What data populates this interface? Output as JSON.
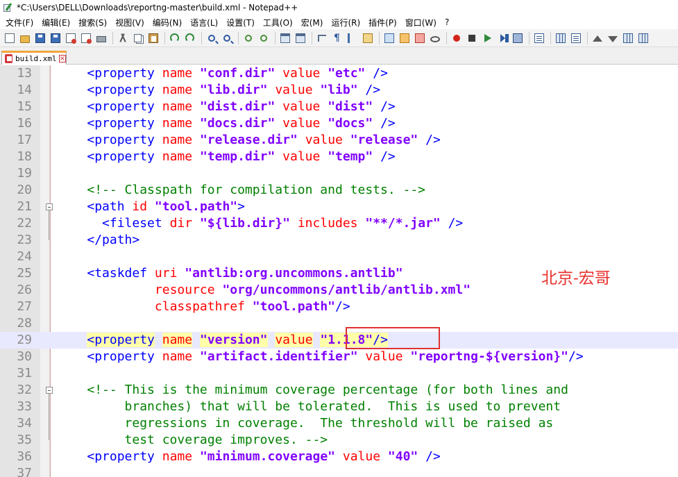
{
  "window": {
    "title": "*C:\\Users\\DELL\\Downloads\\reportng-master\\build.xml - Notepad++"
  },
  "menu": [
    "文件(F)",
    "编辑(E)",
    "搜索(S)",
    "视图(V)",
    "编码(N)",
    "语言(L)",
    "设置(T)",
    "工具(O)",
    "宏(M)",
    "运行(R)",
    "插件(P)",
    "窗口(W)",
    "?"
  ],
  "toolbar_icons": [
    "new-file-icon",
    "open-folder-icon",
    "save-icon",
    "save-all-icon",
    "close-file-icon",
    "close-all-icon",
    "print-icon",
    "cut-icon",
    "copy-icon",
    "paste-icon",
    "undo-icon",
    "redo-icon",
    "find-icon",
    "replace-icon",
    "zoom-in-icon",
    "zoom-out-icon",
    "sync-vertical-icon",
    "sync-horizontal-icon",
    "word-wrap-icon",
    "show-all-chars-icon",
    "indent-guide-icon",
    "lang-icon",
    "doc-map-icon",
    "function-list-icon",
    "folder-workspace-icon",
    "monitor-icon",
    "record-macro-icon",
    "stop-macro-icon",
    "play-macro-icon",
    "run-macro-multiple-icon",
    "save-macro-icon",
    "function-icon",
    "list-icon",
    "view-icon",
    "arrow-up-icon",
    "arrow-down-icon",
    "toggle-icon",
    "panel-icon"
  ],
  "tab": {
    "label": "build.xml"
  },
  "colors": {
    "tag": "#0000ff",
    "attr": "#ff0000",
    "string": "#8000ff",
    "comment": "#008000",
    "current_line": "#e8e8ff",
    "match_highlight": "#ffffaa",
    "annotation": "#e8322d",
    "box": "#e03030"
  },
  "annotation": "北京-宏哥",
  "code_lines": [
    {
      "n": "13",
      "tokens": [
        [
          "ws",
          "    "
        ],
        [
          "tag",
          "<property"
        ],
        [
          "ws",
          " "
        ],
        [
          "attr",
          "name"
        ],
        [
          "ws",
          " "
        ],
        [
          "str",
          "\"conf.dir\""
        ],
        [
          "ws",
          " "
        ],
        [
          "attr",
          "value"
        ],
        [
          "ws",
          " "
        ],
        [
          "str",
          "\"etc\""
        ],
        [
          "ws",
          " "
        ],
        [
          "tag",
          "/>"
        ]
      ]
    },
    {
      "n": "14",
      "tokens": [
        [
          "ws",
          "    "
        ],
        [
          "tag",
          "<property"
        ],
        [
          "ws",
          " "
        ],
        [
          "attr",
          "name"
        ],
        [
          "ws",
          " "
        ],
        [
          "str",
          "\"lib.dir\""
        ],
        [
          "ws",
          " "
        ],
        [
          "attr",
          "value"
        ],
        [
          "ws",
          " "
        ],
        [
          "str",
          "\"lib\""
        ],
        [
          "ws",
          " "
        ],
        [
          "tag",
          "/>"
        ]
      ]
    },
    {
      "n": "15",
      "tokens": [
        [
          "ws",
          "    "
        ],
        [
          "tag",
          "<property"
        ],
        [
          "ws",
          " "
        ],
        [
          "attr",
          "name"
        ],
        [
          "ws",
          " "
        ],
        [
          "str",
          "\"dist.dir\""
        ],
        [
          "ws",
          " "
        ],
        [
          "attr",
          "value"
        ],
        [
          "ws",
          " "
        ],
        [
          "str",
          "\"dist\""
        ],
        [
          "ws",
          " "
        ],
        [
          "tag",
          "/>"
        ]
      ]
    },
    {
      "n": "16",
      "tokens": [
        [
          "ws",
          "    "
        ],
        [
          "tag",
          "<property"
        ],
        [
          "ws",
          " "
        ],
        [
          "attr",
          "name"
        ],
        [
          "ws",
          " "
        ],
        [
          "str",
          "\"docs.dir\""
        ],
        [
          "ws",
          " "
        ],
        [
          "attr",
          "value"
        ],
        [
          "ws",
          " "
        ],
        [
          "str",
          "\"docs\""
        ],
        [
          "ws",
          " "
        ],
        [
          "tag",
          "/>"
        ]
      ]
    },
    {
      "n": "17",
      "tokens": [
        [
          "ws",
          "    "
        ],
        [
          "tag",
          "<property"
        ],
        [
          "ws",
          " "
        ],
        [
          "attr",
          "name"
        ],
        [
          "ws",
          " "
        ],
        [
          "str",
          "\"release.dir\""
        ],
        [
          "ws",
          " "
        ],
        [
          "attr",
          "value"
        ],
        [
          "ws",
          " "
        ],
        [
          "str",
          "\"release\""
        ],
        [
          "ws",
          " "
        ],
        [
          "tag",
          "/>"
        ]
      ]
    },
    {
      "n": "18",
      "tokens": [
        [
          "ws",
          "    "
        ],
        [
          "tag",
          "<property"
        ],
        [
          "ws",
          " "
        ],
        [
          "attr",
          "name"
        ],
        [
          "ws",
          " "
        ],
        [
          "str",
          "\"temp.dir\""
        ],
        [
          "ws",
          " "
        ],
        [
          "attr",
          "value"
        ],
        [
          "ws",
          " "
        ],
        [
          "str",
          "\"temp\""
        ],
        [
          "ws",
          " "
        ],
        [
          "tag",
          "/>"
        ]
      ]
    },
    {
      "n": "19",
      "tokens": []
    },
    {
      "n": "20",
      "tokens": [
        [
          "ws",
          "    "
        ],
        [
          "cmt",
          "<!-- Classpath for compilation and tests. -->"
        ]
      ]
    },
    {
      "n": "21",
      "fold": true,
      "tokens": [
        [
          "ws",
          "    "
        ],
        [
          "tag",
          "<path"
        ],
        [
          "ws",
          " "
        ],
        [
          "attr",
          "id"
        ],
        [
          "ws",
          " "
        ],
        [
          "str",
          "\"tool.path\""
        ],
        [
          "tag",
          ">"
        ]
      ]
    },
    {
      "n": "22",
      "tokens": [
        [
          "ws",
          "      "
        ],
        [
          "tag",
          "<fileset"
        ],
        [
          "ws",
          " "
        ],
        [
          "attr",
          "dir"
        ],
        [
          "ws",
          " "
        ],
        [
          "str",
          "\"${lib.dir}\""
        ],
        [
          "ws",
          " "
        ],
        [
          "attr",
          "includes"
        ],
        [
          "ws",
          " "
        ],
        [
          "str",
          "\"**/*.jar\""
        ],
        [
          "ws",
          " "
        ],
        [
          "tag",
          "/>"
        ]
      ]
    },
    {
      "n": "23",
      "tokens": [
        [
          "ws",
          "    "
        ],
        [
          "tag",
          "</path>"
        ]
      ]
    },
    {
      "n": "24",
      "tokens": []
    },
    {
      "n": "25",
      "tokens": [
        [
          "ws",
          "    "
        ],
        [
          "tag",
          "<taskdef"
        ],
        [
          "ws",
          " "
        ],
        [
          "attr",
          "uri"
        ],
        [
          "ws",
          " "
        ],
        [
          "str",
          "\"antlib:org.uncommons.antlib\""
        ]
      ]
    },
    {
      "n": "26",
      "tokens": [
        [
          "ws",
          "             "
        ],
        [
          "attr",
          "resource"
        ],
        [
          "ws",
          " "
        ],
        [
          "str",
          "\"org/uncommons/antlib/antlib.xml\""
        ]
      ]
    },
    {
      "n": "27",
      "tokens": [
        [
          "ws",
          "             "
        ],
        [
          "attr",
          "classpathref"
        ],
        [
          "ws",
          " "
        ],
        [
          "str",
          "\"tool.path\""
        ],
        [
          "tag",
          "/>"
        ]
      ]
    },
    {
      "n": "28",
      "tokens": []
    },
    {
      "n": "29",
      "current": true,
      "tokens": [
        [
          "ws",
          "    "
        ],
        [
          "tag-hl",
          "<property"
        ],
        [
          "ws",
          " "
        ],
        [
          "attr-hl",
          "name"
        ],
        [
          "ws",
          " "
        ],
        [
          "str-hl",
          "\"version\""
        ],
        [
          "ws",
          " "
        ],
        [
          "attr-hl",
          "value"
        ],
        [
          "ws",
          " "
        ],
        [
          "str-hl",
          "\"1.1.8\""
        ],
        [
          "tag-hl",
          "/>"
        ]
      ]
    },
    {
      "n": "30",
      "tokens": [
        [
          "ws",
          "    "
        ],
        [
          "tag",
          "<property"
        ],
        [
          "ws",
          " "
        ],
        [
          "attr",
          "name"
        ],
        [
          "ws",
          " "
        ],
        [
          "str",
          "\"artifact.identifier\""
        ],
        [
          "ws",
          " "
        ],
        [
          "attr",
          "value"
        ],
        [
          "ws",
          " "
        ],
        [
          "str",
          "\"reportng-${version}\""
        ],
        [
          "tag",
          "/>"
        ]
      ]
    },
    {
      "n": "31",
      "tokens": []
    },
    {
      "n": "32",
      "fold": true,
      "tokens": [
        [
          "ws",
          "    "
        ],
        [
          "cmt",
          "<!-- This is the minimum coverage percentage (for both lines and"
        ]
      ]
    },
    {
      "n": "33",
      "tokens": [
        [
          "cmt",
          "         branches) that will be tolerated.  This is used to prevent"
        ]
      ]
    },
    {
      "n": "34",
      "tokens": [
        [
          "cmt",
          "         regressions in coverage.  The threshold will be raised as"
        ]
      ]
    },
    {
      "n": "35",
      "tokens": [
        [
          "cmt",
          "         test coverage improves. -->"
        ]
      ]
    },
    {
      "n": "36",
      "tokens": [
        [
          "ws",
          "    "
        ],
        [
          "tag",
          "<property"
        ],
        [
          "ws",
          " "
        ],
        [
          "attr",
          "name"
        ],
        [
          "ws",
          " "
        ],
        [
          "str",
          "\"minimum.coverage\""
        ],
        [
          "ws",
          " "
        ],
        [
          "attr",
          "value"
        ],
        [
          "ws",
          " "
        ],
        [
          "str",
          "\"40\""
        ],
        [
          "ws",
          " "
        ],
        [
          "tag",
          "/>"
        ]
      ]
    },
    {
      "n": "37",
      "tokens": []
    }
  ]
}
